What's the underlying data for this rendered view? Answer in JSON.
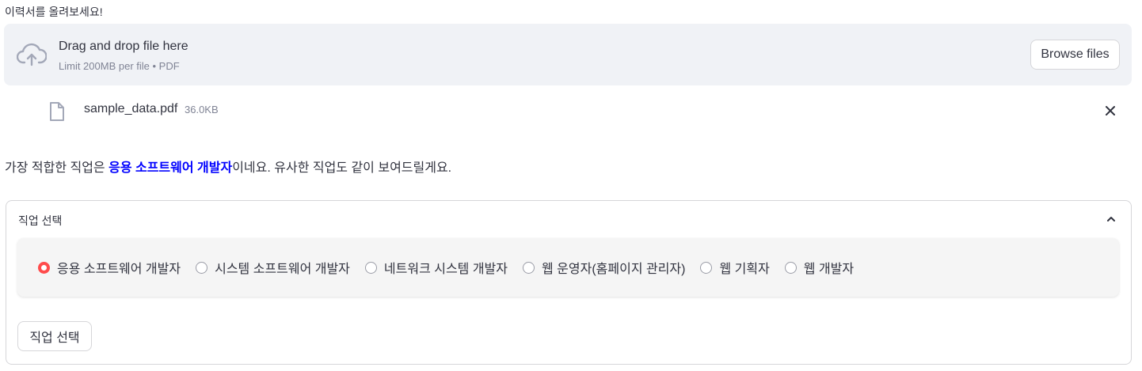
{
  "uploader": {
    "label": "이력서를 올려보세요!",
    "drop_title": "Drag and drop file here",
    "limit": "Limit 200MB per file • PDF",
    "browse_label": "Browse files",
    "icon": "cloud-upload-icon"
  },
  "file": {
    "name": "sample_data.pdf",
    "size": "36.0KB",
    "icon": "file-icon",
    "remove_icon": "close-icon"
  },
  "result": {
    "prefix": "가장 적합한 직업은 ",
    "job": "응용 소프트웨어 개발자",
    "suffix": "이네요. 유사한 직업도 같이 보여드릴게요.",
    "job_color": "#0000ff"
  },
  "expander": {
    "title": "직업 선택",
    "icon": "chevron-up-icon",
    "options": [
      {
        "label": "응용 소프트웨어 개발자",
        "checked": true
      },
      {
        "label": "시스템 소프트웨어 개발자",
        "checked": false
      },
      {
        "label": "네트워크 시스템 개발자",
        "checked": false
      },
      {
        "label": "웹 운영자(홈페이지 관리자)",
        "checked": false
      },
      {
        "label": "웹 기획자",
        "checked": false
      },
      {
        "label": "웹 개발자",
        "checked": false
      }
    ],
    "button_label": "직업 선택"
  },
  "colors": {
    "accent": "#ff4b4b",
    "dropzone_bg": "#f0f2f6",
    "text": "#31333f",
    "muted": "#808495"
  }
}
